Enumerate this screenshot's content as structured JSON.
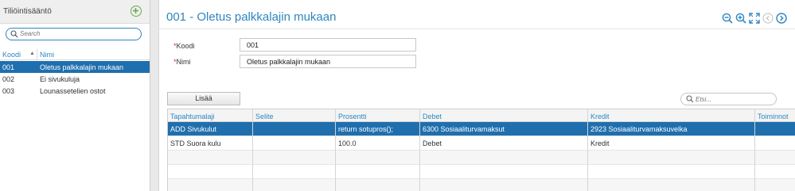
{
  "left": {
    "title": "Tiliöintisääntö",
    "add_icon": "plus-circle-icon",
    "search_placeholder": "Search",
    "columns": {
      "code": "Koodi",
      "name": "Nimi"
    },
    "rows": [
      {
        "code": "001",
        "name": "Oletus palkkalajin mukaan",
        "selected": true
      },
      {
        "code": "002",
        "name": "Ei sivukuluja",
        "selected": false
      },
      {
        "code": "003",
        "name": "Lounassetelien ostot",
        "selected": false
      }
    ]
  },
  "main": {
    "title": "001 - Oletus palkkalajin mukaan",
    "toolbar_icons": [
      "zoom-out-icon",
      "zoom-in-icon",
      "expand-icon",
      "previous-icon",
      "next-icon"
    ],
    "form": {
      "koodi_label": "Koodi",
      "koodi_value": "001",
      "nimi_label": "Nimi",
      "nimi_value": "Oletus palkkalajin mukaan",
      "required_mark": "*"
    },
    "add_button": "Lisää",
    "search_placeholder": "Etsi...",
    "grid": {
      "columns": [
        "Tapahtumalaji",
        "Selite",
        "Prosentti",
        "Debet",
        "Kredit",
        "Toiminnot"
      ],
      "rows": [
        {
          "tapahtumalaji": "ADD Sivukulut",
          "selite": "",
          "prosentti": "return sotupros();",
          "debet": "6300 Sosiaaliturvamaksut",
          "kredit": "2923 Sosiaaliturvamaksuvelka",
          "selected": true
        },
        {
          "tapahtumalaji": "STD Suora kulu",
          "selite": "",
          "prosentti": "100.0",
          "debet": "Debet",
          "kredit": "Kredit",
          "selected": false
        }
      ]
    }
  },
  "colors": {
    "accent": "#2e86c1",
    "selected": "#1f6fae",
    "add": "#6aa84f"
  }
}
